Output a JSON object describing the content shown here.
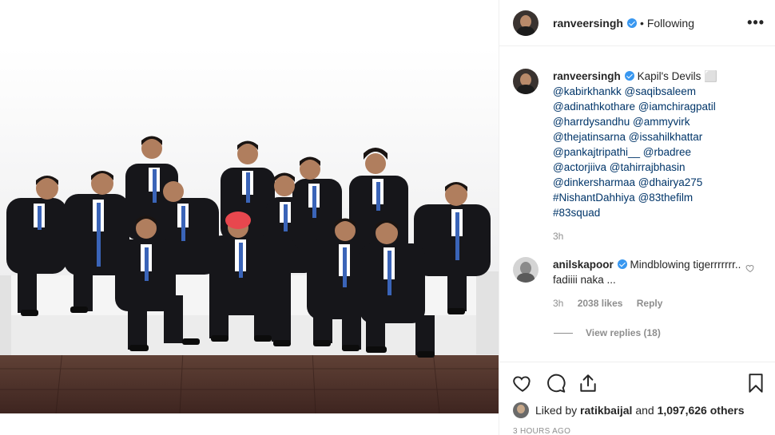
{
  "post": {
    "username": "ranveersingh",
    "follow_status": "Following",
    "more_label": "•••",
    "time_ago": "3 HOURS AGO"
  },
  "caption": {
    "username": "ranveersingh",
    "title": "Kapil's Devils",
    "title_emoji": "⬜",
    "mentions": [
      "@kabirkhankk",
      "@saqibsaleem",
      "@adinathkothare",
      "@iamchiragpatil",
      "@harrdysandhu",
      "@ammyvirk",
      "@thejatinsarna",
      "@issahilkhattar",
      "@pankajtripathi__",
      "@rbadree",
      "@actorjiiva",
      "@tahirrajbhasin",
      "@dinkersharmaa",
      "@dhairya275",
      "#NishantDahhiya",
      "@83thefilm",
      "#83squad"
    ],
    "time": "3h"
  },
  "comment": {
    "username": "anilskapoor",
    "text": "Mindblowing tigerrrrrrr.. fadiiii naka ...",
    "time": "3h",
    "likes": "2038 likes",
    "reply_label": "Reply",
    "view_replies": "View replies (18)"
  },
  "likes": {
    "prefix": "Liked by",
    "user": "ratikbaijal",
    "connector": "and",
    "others": "1,097,626 others"
  },
  "icons": {
    "like": "heart-icon",
    "comment": "comment-icon",
    "share": "share-icon",
    "save": "bookmark-icon",
    "verified": "verified-badge-icon",
    "more": "more-options-icon"
  },
  "colors": {
    "verified_blue": "#3897f0",
    "mention_blue": "#003569",
    "meta_grey": "#8e8e8e",
    "text_dark": "#262626"
  }
}
